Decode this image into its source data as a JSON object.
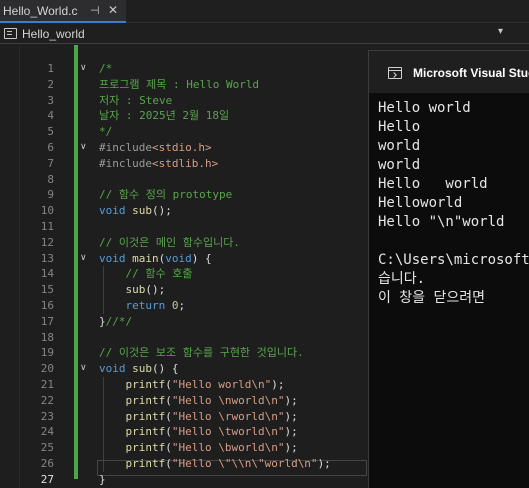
{
  "tab": {
    "title": "Hello_World.c",
    "pin_glyph": "⊣",
    "close_glyph": "✕"
  },
  "nav": {
    "scope": "Hello_world",
    "dropdown_glyph": "▾"
  },
  "editor": {
    "line_numbers": [
      "1",
      "2",
      "3",
      "4",
      "5",
      "6",
      "7",
      "8",
      "9",
      "10",
      "11",
      "12",
      "13",
      "14",
      "15",
      "16",
      "17",
      "18",
      "19",
      "20",
      "21",
      "22",
      "23",
      "24",
      "25",
      "26",
      "27"
    ],
    "current_line": "27",
    "lines": [
      [
        [
          "cmt",
          "/*"
        ]
      ],
      [
        [
          "cmt",
          "프로그램 제목 : Hello World"
        ]
      ],
      [
        [
          "cmt",
          "저자 : Steve"
        ]
      ],
      [
        [
          "cmt",
          "날자 : 2025년 2월 18일"
        ]
      ],
      [
        [
          "cmt",
          "*/"
        ]
      ],
      [
        [
          "pp",
          "#include"
        ],
        [
          "inc",
          "<stdio.h>"
        ]
      ],
      [
        [
          "pp",
          "#include"
        ],
        [
          "inc",
          "<stdlib.h>"
        ]
      ],
      [],
      [
        [
          "cmt",
          "// 함수 정의 prototype"
        ]
      ],
      [
        [
          "kw",
          "void "
        ],
        [
          "fn",
          "sub"
        ],
        [
          "pl",
          "();"
        ]
      ],
      [],
      [
        [
          "cmt",
          "// 이것은 메인 함수입니다."
        ]
      ],
      [
        [
          "kw",
          "void "
        ],
        [
          "fn",
          "main"
        ],
        [
          "pl",
          "("
        ],
        [
          "kw",
          "void"
        ],
        [
          "pl",
          ") {"
        ]
      ],
      [
        [
          "cmt",
          "    // 함수 호출"
        ]
      ],
      [
        [
          "fn",
          "    sub"
        ],
        [
          "pl",
          "();"
        ]
      ],
      [
        [
          "kw",
          "    return "
        ],
        [
          "num",
          "0"
        ],
        [
          "pl",
          ";"
        ]
      ],
      [
        [
          "pl",
          "}"
        ],
        [
          "cmt",
          "//*/"
        ]
      ],
      [],
      [
        [
          "cmt",
          "// 이것은 보조 함수를 구현한 것입니다."
        ]
      ],
      [
        [
          "kw",
          "void "
        ],
        [
          "fn",
          "sub"
        ],
        [
          "pl",
          "() {"
        ]
      ],
      [
        [
          "fn",
          "    printf"
        ],
        [
          "pl",
          "("
        ],
        [
          "str",
          "\"Hello world\\n\""
        ],
        [
          "pl",
          ");"
        ]
      ],
      [
        [
          "fn",
          "    printf"
        ],
        [
          "pl",
          "("
        ],
        [
          "str",
          "\"Hello \\nworld\\n\""
        ],
        [
          "pl",
          ");"
        ]
      ],
      [
        [
          "fn",
          "    printf"
        ],
        [
          "pl",
          "("
        ],
        [
          "str",
          "\"Hello \\rworld\\n\""
        ],
        [
          "pl",
          ");"
        ]
      ],
      [
        [
          "fn",
          "    printf"
        ],
        [
          "pl",
          "("
        ],
        [
          "str",
          "\"Hello \\tworld\\n\""
        ],
        [
          "pl",
          ");"
        ]
      ],
      [
        [
          "fn",
          "    printf"
        ],
        [
          "pl",
          "("
        ],
        [
          "str",
          "\"Hello \\bworld\\n\""
        ],
        [
          "pl",
          ");"
        ]
      ],
      [
        [
          "fn",
          "    printf"
        ],
        [
          "pl",
          "("
        ],
        [
          "str",
          "\"Hello \\\"\\\\n\\\"world\\n\""
        ],
        [
          "pl",
          ");"
        ]
      ],
      [
        [
          "pl",
          "}"
        ]
      ]
    ],
    "fold_glyph": "∨",
    "colors": {
      "comment": "#57a64a",
      "keyword": "#569cd6",
      "preprocessor": "#9b9b9b",
      "include": "#d69d85",
      "function": "#dcdcaa",
      "string": "#d69d85",
      "number": "#b5cea8",
      "change_bar": "#4ca64c"
    }
  },
  "console": {
    "title": "Microsoft Visual Studio",
    "output": [
      "Hello world",
      "Hello",
      "world",
      "world",
      "Hello   world",
      "Helloworld",
      "Hello \"\\n\"world",
      "",
      "C:\\Users\\microsoft",
      "습니다.",
      "이 창을 닫으려면"
    ]
  }
}
